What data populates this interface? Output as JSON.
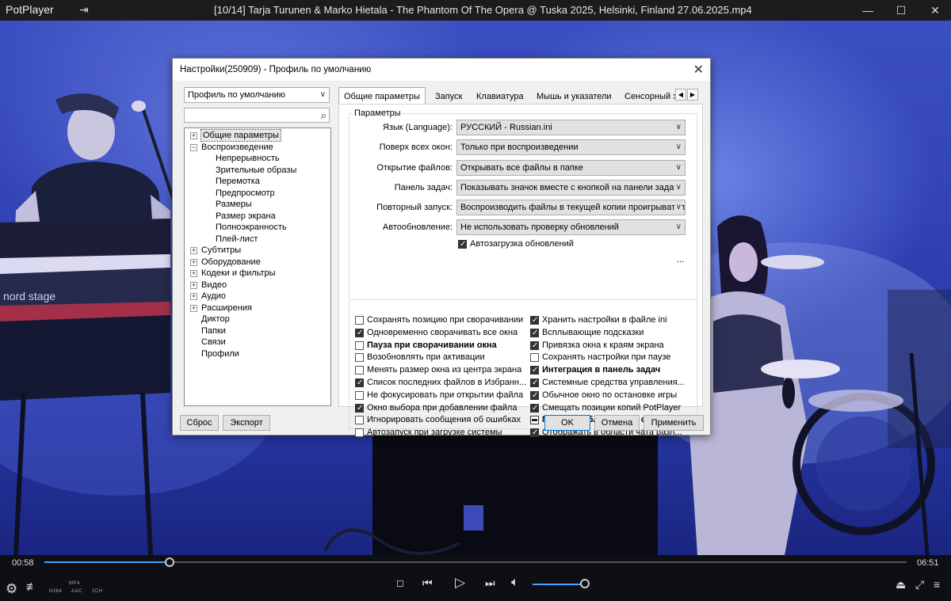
{
  "app": {
    "name": "PotPlayer",
    "window_title": "[10/14] Tarja Turunen & Marko Hietala - The Phantom Of The Opera @ Tuska 2025, Helsinki, Finland 27.06.2025.mp4"
  },
  "video": {
    "overlay_text": "nord stage"
  },
  "controls": {
    "time_current": "00:58",
    "time_total": "06:51",
    "progress": 0.145,
    "volume": 0.95,
    "codec_top": "MP4",
    "codec_video": "H264",
    "codec_audio": "AAC",
    "codec_channels": "2CH"
  },
  "dialog": {
    "title": "Настройки(250909) - Профиль по умолчанию",
    "profile_combo": "Профиль по умолчанию",
    "tree": [
      {
        "label": "Общие параметры",
        "expander": "+",
        "level": 0,
        "selected": true
      },
      {
        "label": "Воспроизведение",
        "expander": "−",
        "level": 0
      },
      {
        "label": "Непрерывность",
        "level": 1
      },
      {
        "label": "Зрительные образы",
        "level": 1
      },
      {
        "label": "Перемотка",
        "level": 1
      },
      {
        "label": "Предпросмотр",
        "level": 1
      },
      {
        "label": "Размеры",
        "level": 1
      },
      {
        "label": "Размер экрана",
        "level": 1
      },
      {
        "label": "Полноэкранность",
        "level": 1
      },
      {
        "label": "Плей-лист",
        "level": 1
      },
      {
        "label": "Субтитры",
        "expander": "+",
        "level": 0
      },
      {
        "label": "Оборудование",
        "expander": "+",
        "level": 0
      },
      {
        "label": "Кодеки и фильтры",
        "expander": "+",
        "level": 0
      },
      {
        "label": "Видео",
        "expander": "+",
        "level": 0
      },
      {
        "label": "Аудио",
        "expander": "+",
        "level": 0
      },
      {
        "label": "Расширения",
        "expander": "+",
        "level": 0
      },
      {
        "label": "Диктор",
        "level": 0
      },
      {
        "label": "Папки",
        "level": 0
      },
      {
        "label": "Связи",
        "level": 0
      },
      {
        "label": "Профили",
        "level": 0
      }
    ],
    "tabs": [
      "Общие параметры",
      "Запуск",
      "Клавиатура",
      "Мышь и указатели",
      "Сенсорный э"
    ],
    "group_label": "Параметры",
    "fields": [
      {
        "label": "Язык (Language):",
        "value": "РУССКИЙ - Russian.ini"
      },
      {
        "label": "Поверх всех окон:",
        "value": "Только при воспроизведении"
      },
      {
        "label": "Открытие файлов:",
        "value": "Открывать все файлы в папке"
      },
      {
        "label": "Панель задач:",
        "value": "Показывать значок вместе с кнопкой на панели задач"
      },
      {
        "label": "Повторный запуск:",
        "value": "Воспроизводить файлы в текущей копии проигрывателя"
      },
      {
        "label": "Автообновление:",
        "value": "Не использовать проверку обновлений"
      }
    ],
    "autoload_check": {
      "label": "Автозагрузка обновлений",
      "checked": true
    },
    "checks_left": [
      {
        "label": "Сохранять позицию при сворачивании",
        "state": "off"
      },
      {
        "label": "Одновременно сворачивать все окна",
        "state": "on"
      },
      {
        "label": "Пауза при сворачивании окна",
        "state": "off",
        "bold": true
      },
      {
        "label": "Возобновлять при активации",
        "state": "off"
      },
      {
        "label": "Менять размер окна из центра экрана",
        "state": "off"
      },
      {
        "label": "Список последних файлов в Избранн...",
        "state": "on"
      },
      {
        "label": "Не фокусировать при открытии файла",
        "state": "off"
      },
      {
        "label": "Окно выбора при добавлении файла",
        "state": "on"
      },
      {
        "label": "Игнорировать сообщения об ошибках",
        "state": "off"
      },
      {
        "label": "Автозапуск при загрузке системы",
        "state": "off"
      }
    ],
    "checks_right": [
      {
        "label": "Хранить настройки в файле ini",
        "state": "on"
      },
      {
        "label": "Всплывающие подсказки",
        "state": "on"
      },
      {
        "label": "Привязка окна к краям экрана",
        "state": "on"
      },
      {
        "label": "Сохранять настройки при паузе",
        "state": "off"
      },
      {
        "label": "Интеграция в панель задач",
        "state": "on",
        "bold": true
      },
      {
        "label": "Системные средства управления...",
        "state": "on"
      },
      {
        "label": "Обычное окно по остановке игры",
        "state": "on"
      },
      {
        "label": "Смещать позиции копий PotPlayer",
        "state": "on"
      },
      {
        "label": "Пауза при блокировке окна",
        "state": "ind",
        "bold": true
      },
      {
        "label": "Отображать в области чата разл...",
        "state": "on"
      }
    ],
    "more_label": "...",
    "buttons": {
      "reset": "Сброс",
      "export": "Экспорт",
      "ok": "OK",
      "cancel": "Отмена",
      "apply": "Применить"
    }
  }
}
